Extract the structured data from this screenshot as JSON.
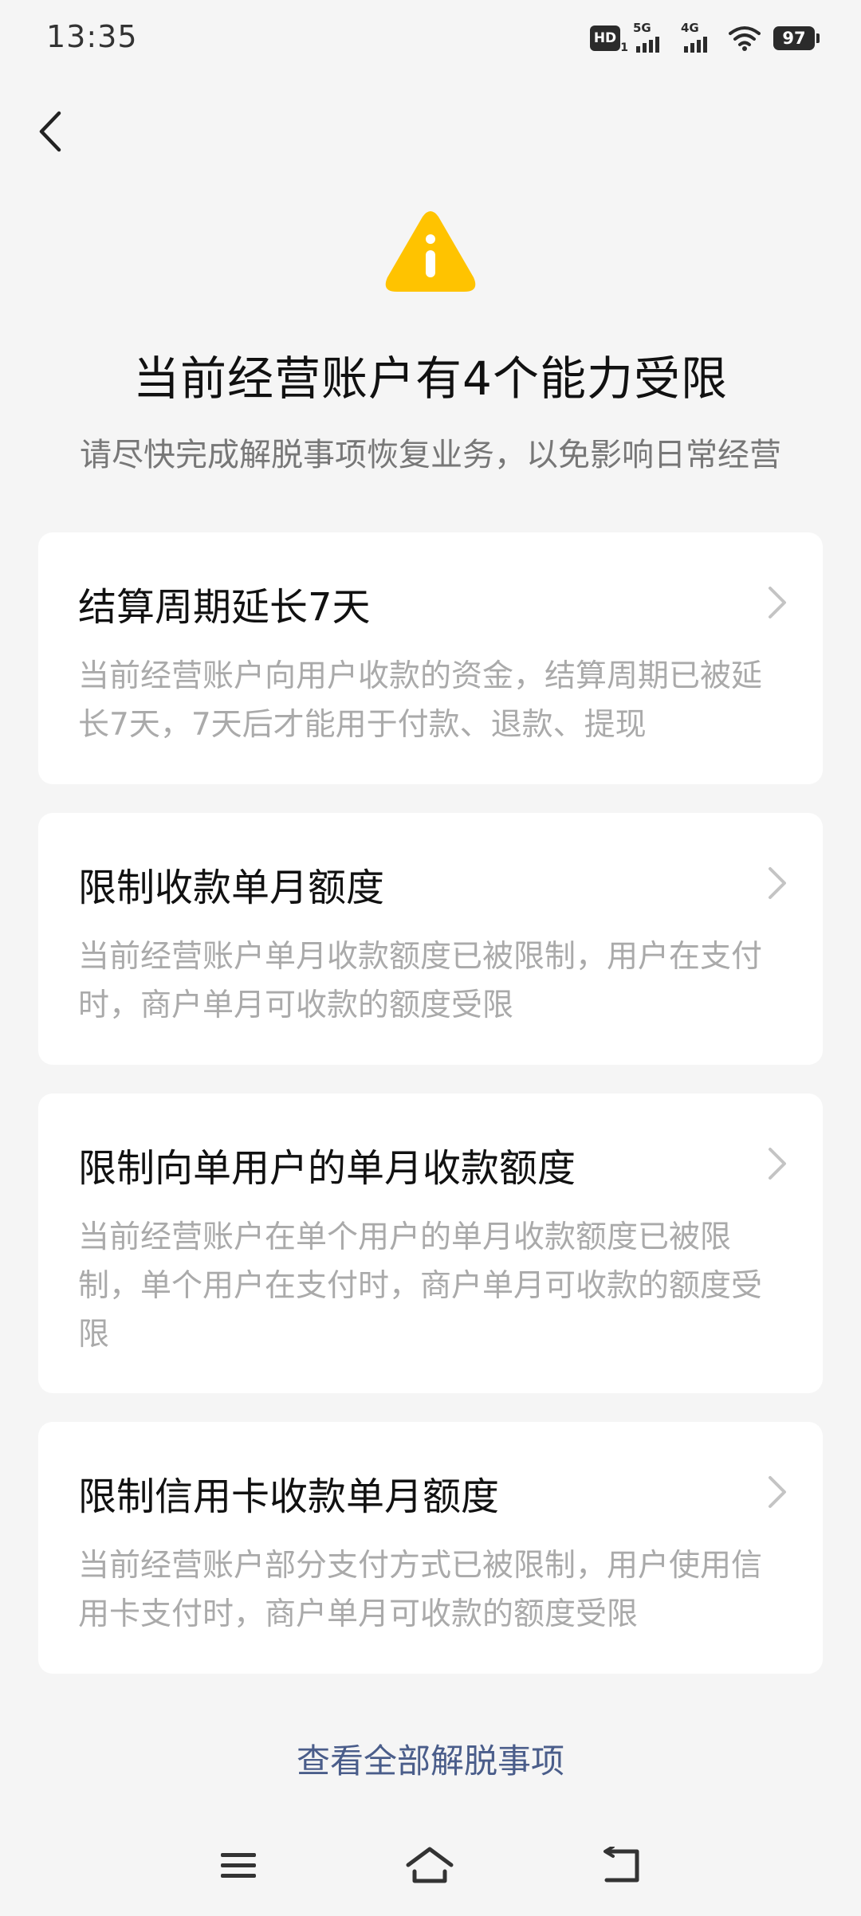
{
  "status_bar": {
    "time": "13:35",
    "hd_label": "HD",
    "hd_sub": "1",
    "net1": "5G",
    "net2": "4G",
    "battery": "97"
  },
  "header": {
    "title": "当前经营账户有4个能力受限",
    "subtitle": "请尽快完成解脱事项恢复业务，以免影响日常经营"
  },
  "cards": [
    {
      "title": "结算周期延长7天",
      "desc": "当前经营账户向用户收款的资金，结算周期已被延长7天，7天后才能用于付款、退款、提现"
    },
    {
      "title": "限制收款单月额度",
      "desc": "当前经营账户单月收款额度已被限制，用户在支付时，商户单月可收款的额度受限"
    },
    {
      "title": "限制向单用户的单月收款额度",
      "desc": "当前经营账户在单个用户的单月收款额度已被限制，单个用户在支付时，商户单月可收款的额度受限"
    },
    {
      "title": "限制信用卡收款单月额度",
      "desc": "当前经营账户部分支付方式已被限制，用户使用信用卡支付时，商户单月可收款的额度受限"
    }
  ],
  "footer": {
    "view_all": "查看全部解脱事项"
  },
  "colors": {
    "warning": "#ffc300",
    "link": "#4a5d8a",
    "background": "#f5f5f5"
  }
}
